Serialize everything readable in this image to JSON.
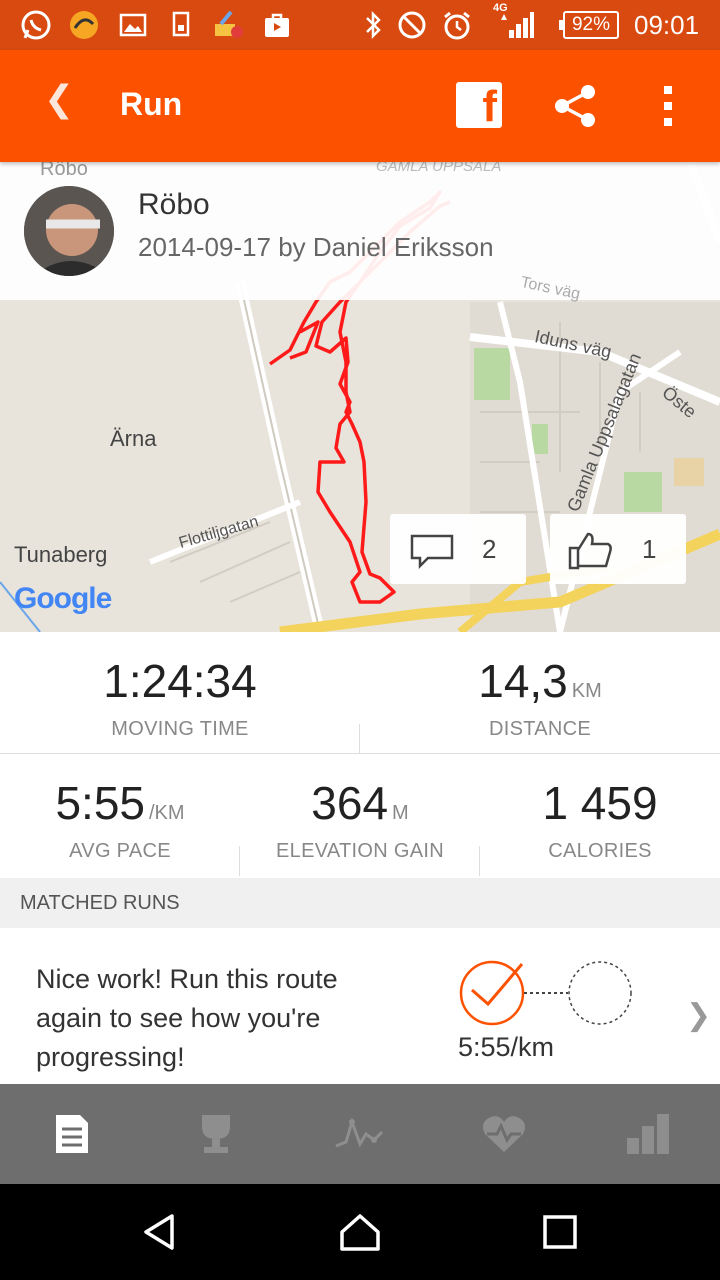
{
  "status_bar": {
    "network": "4G",
    "battery": "92%",
    "time": "09:01"
  },
  "app_bar": {
    "title": "Run",
    "back_icon": "chevron-left-icon",
    "facebook_icon": "facebook-icon",
    "facebook_glyph": "f",
    "share_icon": "share-icon",
    "more_icon": "more-vert-icon"
  },
  "activity": {
    "name": "Röbo",
    "meta": "2014-09-17 by Daniel Eriksson"
  },
  "map": {
    "places": [
      "Röbo",
      "GAMLA UPPSALA",
      "Ärna",
      "Tunaberg"
    ],
    "streets": [
      "Tors väg",
      "Iduns väg",
      "Gamla Uppsalagatan",
      "Öste",
      "Flottiljgatan"
    ],
    "attribution": "Google",
    "comments_count": "2",
    "kudos_count": "1"
  },
  "stats": {
    "moving_time": {
      "value": "1:24:34",
      "label": "MOVING TIME"
    },
    "distance": {
      "value": "14,3",
      "unit": "KM",
      "label": "DISTANCE"
    },
    "avg_pace": {
      "value": "5:55",
      "unit": "/KM",
      "label": "AVG PACE"
    },
    "elevation_gain": {
      "value": "364",
      "unit": "M",
      "label": "ELEVATION GAIN"
    },
    "calories": {
      "value": "1 459",
      "label": "CALORIES"
    }
  },
  "matched_runs": {
    "header": "MATCHED RUNS",
    "message": "Nice work! Run this route again to see how you're progressing!",
    "pace": "5:55/km"
  },
  "tabs": [
    "feed-icon",
    "trophy-icon",
    "activity-graph-icon",
    "heart-icon",
    "bar-chart-icon"
  ],
  "colors": {
    "brand": "#fc5200",
    "status_bar": "#d84a10",
    "route": "#ff1a1a",
    "tab_bar": "#6e6e6e"
  }
}
